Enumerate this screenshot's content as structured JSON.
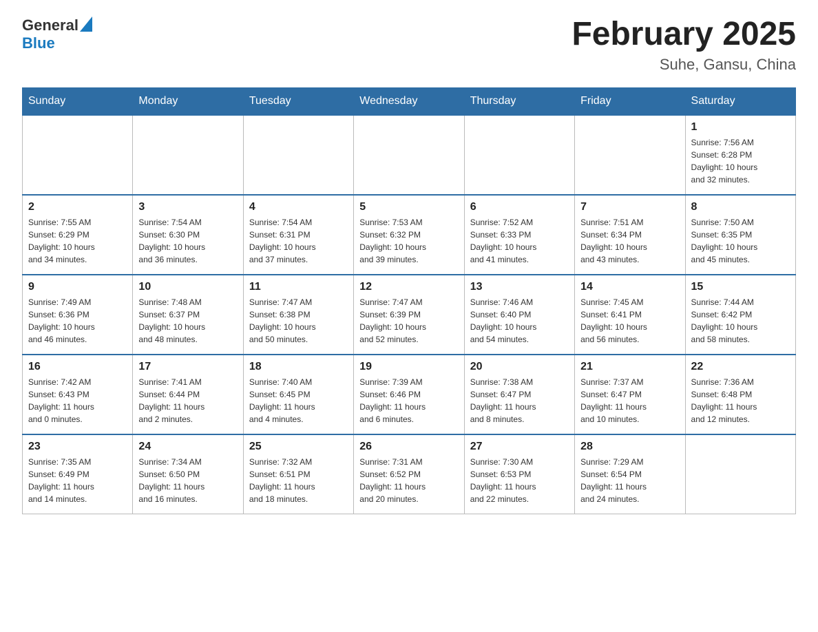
{
  "header": {
    "logo_general": "General",
    "logo_blue": "Blue",
    "title": "February 2025",
    "subtitle": "Suhe, Gansu, China"
  },
  "weekdays": [
    "Sunday",
    "Monday",
    "Tuesday",
    "Wednesday",
    "Thursday",
    "Friday",
    "Saturday"
  ],
  "weeks": [
    [
      {
        "day": "",
        "info": ""
      },
      {
        "day": "",
        "info": ""
      },
      {
        "day": "",
        "info": ""
      },
      {
        "day": "",
        "info": ""
      },
      {
        "day": "",
        "info": ""
      },
      {
        "day": "",
        "info": ""
      },
      {
        "day": "1",
        "info": "Sunrise: 7:56 AM\nSunset: 6:28 PM\nDaylight: 10 hours\nand 32 minutes."
      }
    ],
    [
      {
        "day": "2",
        "info": "Sunrise: 7:55 AM\nSunset: 6:29 PM\nDaylight: 10 hours\nand 34 minutes."
      },
      {
        "day": "3",
        "info": "Sunrise: 7:54 AM\nSunset: 6:30 PM\nDaylight: 10 hours\nand 36 minutes."
      },
      {
        "day": "4",
        "info": "Sunrise: 7:54 AM\nSunset: 6:31 PM\nDaylight: 10 hours\nand 37 minutes."
      },
      {
        "day": "5",
        "info": "Sunrise: 7:53 AM\nSunset: 6:32 PM\nDaylight: 10 hours\nand 39 minutes."
      },
      {
        "day": "6",
        "info": "Sunrise: 7:52 AM\nSunset: 6:33 PM\nDaylight: 10 hours\nand 41 minutes."
      },
      {
        "day": "7",
        "info": "Sunrise: 7:51 AM\nSunset: 6:34 PM\nDaylight: 10 hours\nand 43 minutes."
      },
      {
        "day": "8",
        "info": "Sunrise: 7:50 AM\nSunset: 6:35 PM\nDaylight: 10 hours\nand 45 minutes."
      }
    ],
    [
      {
        "day": "9",
        "info": "Sunrise: 7:49 AM\nSunset: 6:36 PM\nDaylight: 10 hours\nand 46 minutes."
      },
      {
        "day": "10",
        "info": "Sunrise: 7:48 AM\nSunset: 6:37 PM\nDaylight: 10 hours\nand 48 minutes."
      },
      {
        "day": "11",
        "info": "Sunrise: 7:47 AM\nSunset: 6:38 PM\nDaylight: 10 hours\nand 50 minutes."
      },
      {
        "day": "12",
        "info": "Sunrise: 7:47 AM\nSunset: 6:39 PM\nDaylight: 10 hours\nand 52 minutes."
      },
      {
        "day": "13",
        "info": "Sunrise: 7:46 AM\nSunset: 6:40 PM\nDaylight: 10 hours\nand 54 minutes."
      },
      {
        "day": "14",
        "info": "Sunrise: 7:45 AM\nSunset: 6:41 PM\nDaylight: 10 hours\nand 56 minutes."
      },
      {
        "day": "15",
        "info": "Sunrise: 7:44 AM\nSunset: 6:42 PM\nDaylight: 10 hours\nand 58 minutes."
      }
    ],
    [
      {
        "day": "16",
        "info": "Sunrise: 7:42 AM\nSunset: 6:43 PM\nDaylight: 11 hours\nand 0 minutes."
      },
      {
        "day": "17",
        "info": "Sunrise: 7:41 AM\nSunset: 6:44 PM\nDaylight: 11 hours\nand 2 minutes."
      },
      {
        "day": "18",
        "info": "Sunrise: 7:40 AM\nSunset: 6:45 PM\nDaylight: 11 hours\nand 4 minutes."
      },
      {
        "day": "19",
        "info": "Sunrise: 7:39 AM\nSunset: 6:46 PM\nDaylight: 11 hours\nand 6 minutes."
      },
      {
        "day": "20",
        "info": "Sunrise: 7:38 AM\nSunset: 6:47 PM\nDaylight: 11 hours\nand 8 minutes."
      },
      {
        "day": "21",
        "info": "Sunrise: 7:37 AM\nSunset: 6:47 PM\nDaylight: 11 hours\nand 10 minutes."
      },
      {
        "day": "22",
        "info": "Sunrise: 7:36 AM\nSunset: 6:48 PM\nDaylight: 11 hours\nand 12 minutes."
      }
    ],
    [
      {
        "day": "23",
        "info": "Sunrise: 7:35 AM\nSunset: 6:49 PM\nDaylight: 11 hours\nand 14 minutes."
      },
      {
        "day": "24",
        "info": "Sunrise: 7:34 AM\nSunset: 6:50 PM\nDaylight: 11 hours\nand 16 minutes."
      },
      {
        "day": "25",
        "info": "Sunrise: 7:32 AM\nSunset: 6:51 PM\nDaylight: 11 hours\nand 18 minutes."
      },
      {
        "day": "26",
        "info": "Sunrise: 7:31 AM\nSunset: 6:52 PM\nDaylight: 11 hours\nand 20 minutes."
      },
      {
        "day": "27",
        "info": "Sunrise: 7:30 AM\nSunset: 6:53 PM\nDaylight: 11 hours\nand 22 minutes."
      },
      {
        "day": "28",
        "info": "Sunrise: 7:29 AM\nSunset: 6:54 PM\nDaylight: 11 hours\nand 24 minutes."
      },
      {
        "day": "",
        "info": ""
      }
    ]
  ]
}
